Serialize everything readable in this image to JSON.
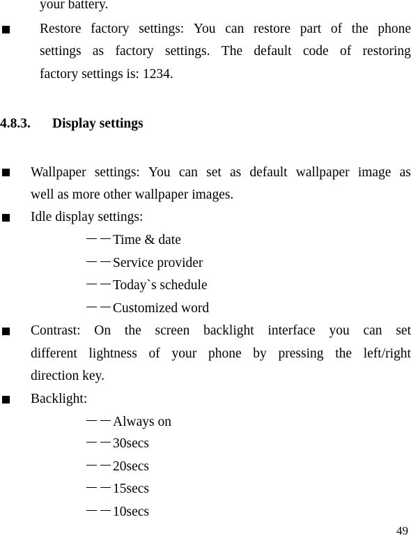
{
  "continuation": "your battery.",
  "restore": {
    "lines": [
      [
        "Restore",
        "factory",
        "settings:",
        "You",
        "can",
        "restore",
        "part",
        "of",
        "the",
        "phone"
      ],
      [
        "settings",
        "as",
        "factory",
        "settings.",
        "The",
        "default",
        "code",
        "of",
        "restoring"
      ]
    ],
    "last": "factory settings is: 1234."
  },
  "section": {
    "number": "4.8.3.",
    "title": "Display settings"
  },
  "wallpaper": {
    "line1": [
      "Wallpaper",
      "settings:",
      "You",
      "can",
      "set",
      "as",
      "default",
      "wallpaper",
      "image",
      "as"
    ],
    "last": "well as more other wallpaper images."
  },
  "idle": {
    "label": "Idle display settings:",
    "options": [
      "Time & date",
      "Service provider",
      "Today`s schedule",
      "Customized word"
    ]
  },
  "contrast": {
    "lines": [
      [
        "Contrast:",
        "On",
        "the",
        "screen",
        "backlight",
        "interface",
        "you",
        "can",
        "set"
      ],
      [
        "different",
        "lightness",
        "of",
        "your",
        "phone",
        "by",
        "pressing",
        "the",
        "left/right"
      ]
    ],
    "last": "direction key."
  },
  "backlight": {
    "label": "Backlight:",
    "options": [
      "Always on",
      "30secs",
      "20secs",
      "15secs",
      "10secs"
    ]
  },
  "page_number": "49"
}
